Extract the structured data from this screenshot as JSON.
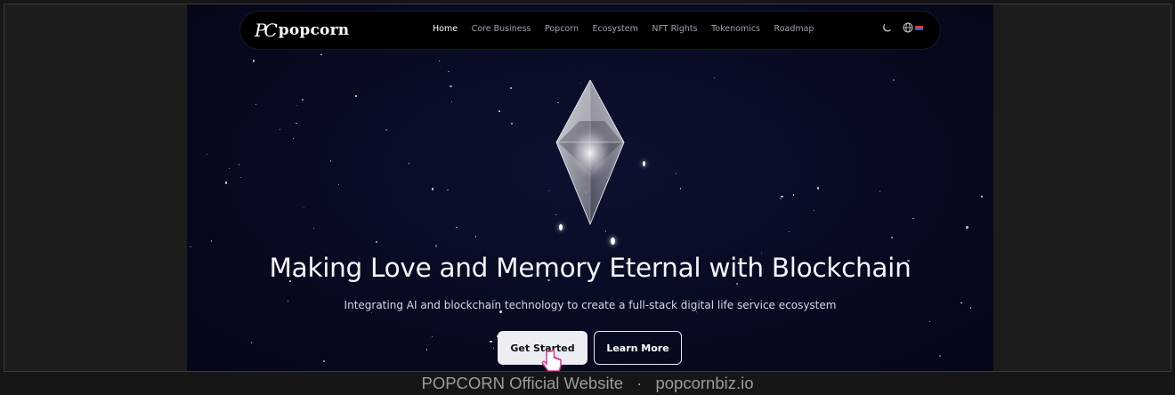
{
  "nav": {
    "logo_mark": "PC",
    "logo_text": "popcorn",
    "items": [
      "Home",
      "Core Business",
      "Popcorn",
      "Ecosystem",
      "NFT Rights",
      "Tokenomics",
      "Roadmap"
    ],
    "active_index": 0,
    "theme_icon": "moon-icon",
    "language_icon": "globe-icon"
  },
  "hero": {
    "headline": "Making Love and Memory Eternal with Blockchain",
    "subheadline": "Integrating AI and blockchain technology to create a full-stack digital life service ecosystem",
    "primary_button": "Get Started",
    "secondary_button": "Learn More"
  },
  "caption": {
    "title": "POPCORN Official Website",
    "separator": "·",
    "domain": "popcornbiz.io"
  },
  "colors": {
    "background": "#070a20",
    "nav_background": "#000000",
    "primary_button_bg": "#eceef4",
    "cursor_accent": "#e0409a"
  }
}
